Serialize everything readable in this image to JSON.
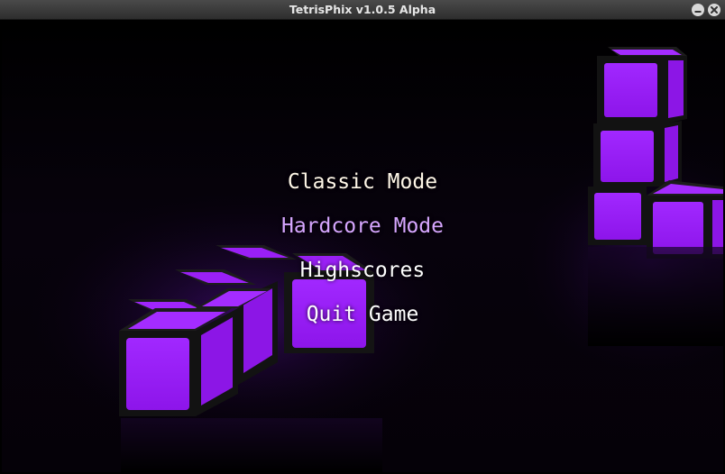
{
  "window": {
    "title": "TetrisPhix v1.0.5 Alpha",
    "controls": [
      "minimize-icon",
      "close-icon"
    ]
  },
  "menu": {
    "items": [
      {
        "label": "Classic Mode",
        "selected": false
      },
      {
        "label": "Hardcore Mode",
        "selected": true
      },
      {
        "label": "Highscores",
        "selected": false
      },
      {
        "label": "Quit Game",
        "selected": false
      }
    ]
  },
  "colors": {
    "block_face": "#9b1ff5",
    "block_edge": "#1a1a1a",
    "background": "#000000",
    "menu_text": "#ffffff",
    "menu_selected": "#d6a6ff",
    "titlebar": "#3a3a3a"
  }
}
